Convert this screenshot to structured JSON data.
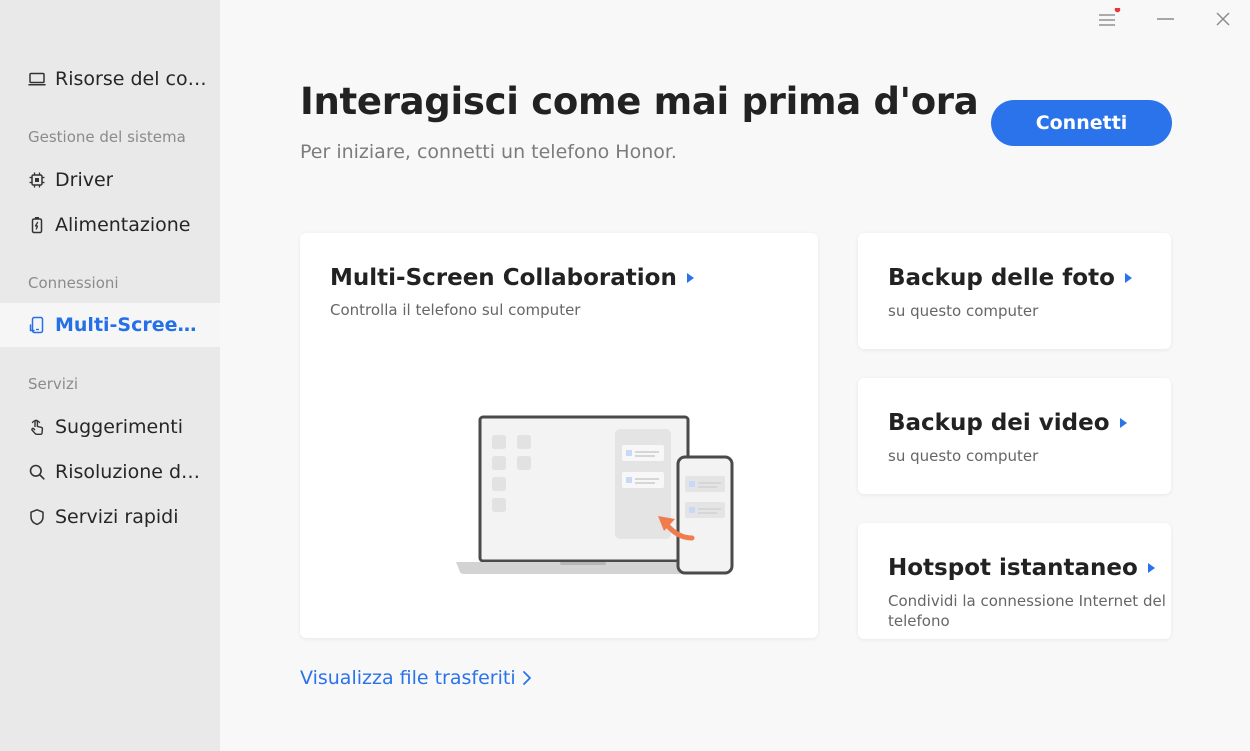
{
  "sidebar": {
    "items": [
      {
        "label": "Risorse del com...",
        "icon": "computer-icon"
      },
      {
        "label": "Driver",
        "icon": "chip-icon"
      },
      {
        "label": "Alimentazione",
        "icon": "battery-icon"
      },
      {
        "label": "Multi-Screen C...",
        "icon": "multiscreen-icon",
        "active": true
      },
      {
        "label": "Suggerimenti",
        "icon": "touch-hand-icon"
      },
      {
        "label": "Risoluzione dei...",
        "icon": "search-icon"
      },
      {
        "label": "Servizi rapidi",
        "icon": "shield-icon"
      }
    ],
    "sections": {
      "system": "Gestione del sistema",
      "connections": "Connessioni",
      "services": "Servizi"
    }
  },
  "window": {
    "controls": [
      "menu-icon",
      "minimize-icon",
      "close-icon"
    ],
    "notification_dot_color": "#e8363b"
  },
  "header": {
    "title": "Interagisci come mai prima d'ora",
    "subtitle": "Per iniziare, connetti un telefono Honor.",
    "connect_label": "Connetti"
  },
  "cards": {
    "multiscreen": {
      "title": "Multi-Screen Collaboration",
      "desc": "Controlla il telefono sul computer"
    },
    "photo_backup": {
      "title": "Backup delle foto",
      "desc": "su questo computer"
    },
    "video_backup": {
      "title": "Backup dei video",
      "desc": "su questo computer"
    },
    "hotspot": {
      "title": "Hotspot istantaneo",
      "desc": "Condividi la connessione Internet del telefono"
    }
  },
  "footer": {
    "transferred_link": "Visualizza file trasferiti"
  },
  "colors": {
    "accent": "#2a73ea",
    "sidebar_bg": "#e9e9e9",
    "main_bg": "#f8f8f8",
    "illustration_accent": "#f07c4e"
  }
}
